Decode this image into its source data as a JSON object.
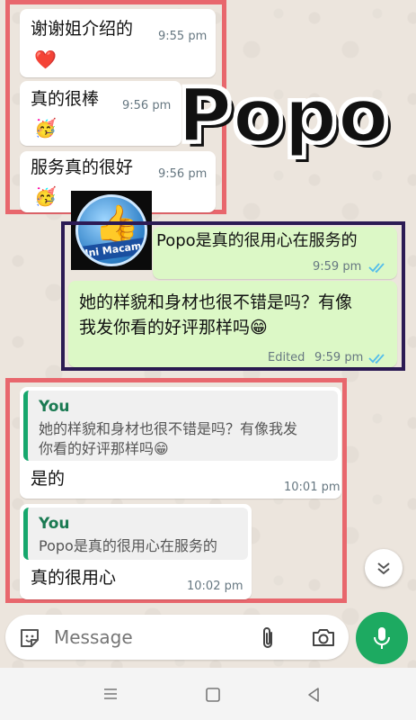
{
  "sticker": {
    "title": "Popo",
    "badge_text": "Ini Macam"
  },
  "messages": {
    "m1": {
      "text": "谢谢姐介绍的",
      "time": "9:55 pm",
      "emoji": "❤️"
    },
    "m2": {
      "text": "真的很棒",
      "time": "9:56 pm",
      "emoji": "🥳"
    },
    "m3": {
      "text": "服务真的很好",
      "time": "9:56 pm",
      "emoji": "🥳"
    },
    "m4": {
      "text": "Popo是真的很用心在服务的",
      "time": "9:59 pm"
    },
    "m5": {
      "line1": "她的样貌和身材也很不错是吗？有像",
      "line2": "我发你看的好评那样吗😁",
      "status": "Edited",
      "time": "9:59 pm"
    },
    "m6": {
      "quote_author": "You",
      "quote_line1": "她的样貌和身材也很不错是吗？有像我发",
      "quote_line2": "你看的好评那样吗😁",
      "text": "是的",
      "time": "10:01 pm"
    },
    "m7": {
      "quote_author": "You",
      "quote_line1": "Popo是真的很用心在服务的",
      "text": "真的很用心",
      "time": "10:02 pm"
    }
  },
  "input": {
    "placeholder": "Message"
  },
  "colors": {
    "accent": "#1daa61",
    "annotation": "#e8676d",
    "outgoing": "#dcf8c6",
    "read_ticks": "#53bdeb"
  },
  "icons": {
    "sticker": "sticker-icon",
    "attach": "paperclip-icon",
    "camera": "camera-icon",
    "mic": "microphone-icon",
    "scroll": "double-chevron-down-icon",
    "ticks": "double-check-icon"
  }
}
